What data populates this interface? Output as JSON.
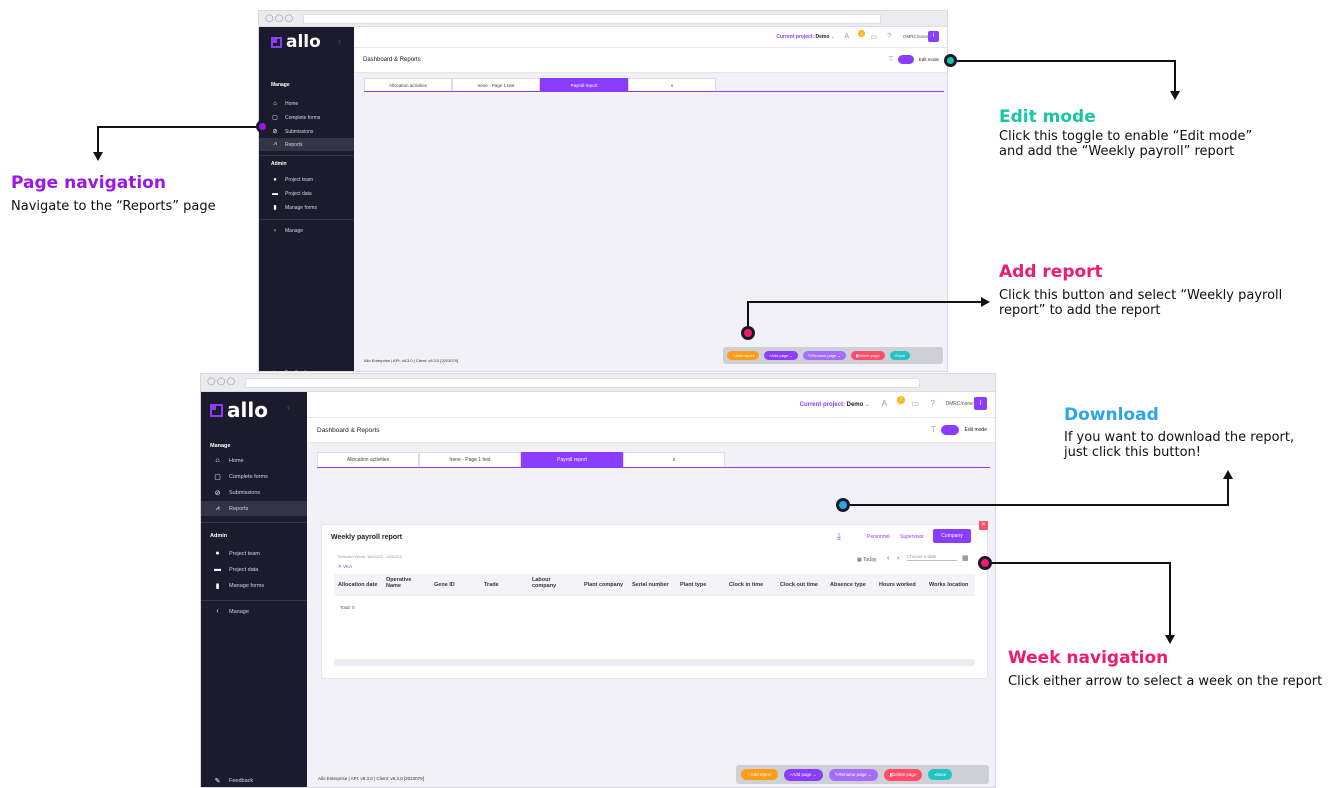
{
  "window_dots": "○○○",
  "logo_text": "allo",
  "sidebar": {
    "manage_label": "Manage",
    "items": [
      {
        "label": "Home",
        "icon": "home-icon",
        "glyph": "⌂"
      },
      {
        "label": "Complete forms",
        "icon": "form-icon",
        "glyph": "▢"
      },
      {
        "label": "Submissions",
        "icon": "submissions-icon",
        "glyph": "⊘"
      },
      {
        "label": "Reports",
        "icon": "reports-icon",
        "glyph": "⩘"
      }
    ],
    "admin_label": "Admin",
    "admin_items": [
      {
        "label": "Project team",
        "icon": "team-icon",
        "glyph": "●"
      },
      {
        "label": "Project data",
        "icon": "data-icon",
        "glyph": "▬"
      },
      {
        "label": "Manage forms",
        "icon": "forms-icon",
        "glyph": "▮"
      }
    ],
    "collapse_label": "Manage",
    "feedback_label": "Feedback"
  },
  "topbar": {
    "current_project_label": "Current project:",
    "current_project_value": "Demo",
    "user_label": "DMRC/none",
    "avatar_letter": "I",
    "notification_count": "3"
  },
  "header": {
    "title": "Dashboard & Reports",
    "edit_mode_label": "Edit mode"
  },
  "tabs": [
    "Allocation activities",
    "Irene - Page 1 test",
    "Payroll report",
    "s"
  ],
  "footer_text": "Allo Enterprise | API: v8.3.0 | Client: v8.3.0 [2023079]",
  "actions": {
    "add_report": "+ Add report",
    "add_page": "Add page ⌄",
    "rename_page": "Rename page ⌄",
    "delete_page": "Delete page",
    "save": "Save"
  },
  "report": {
    "title": "Weekly payroll report",
    "views": [
      "Personnel",
      "Supervisor",
      "Company"
    ],
    "selected_week": "Selected Week: 16/01/23 - 16/01/23",
    "filter_chip": "VKA",
    "today_label": "Today",
    "date_placeholder": "Choose a date",
    "columns": [
      "Allocation date",
      "Operative Name",
      "Gene ID",
      "Trade",
      "Labour company",
      "Plant company",
      "Serial number",
      "Plant type",
      "Clock in time",
      "Clock out time",
      "Absence type",
      "Hours worked",
      "Works location"
    ],
    "total": "Total: 0"
  },
  "annotations": {
    "page_nav": {
      "title": "Page navigation",
      "body": "Navigate to the “Reports” page",
      "color": "#9b16e8"
    },
    "edit_mode": {
      "title": "Edit mode",
      "body": "Click this toggle to enable “Edit mode” and add the “Weekly payroll” report",
      "color": "#17c6a4"
    },
    "add_report": {
      "title": "Add report",
      "body": "Click this button and select “Weekly payroll report” to add the report",
      "color": "#ee1b6e"
    },
    "download": {
      "title": "Download",
      "body": "If you want to download the report, just click this button!",
      "color": "#2aa7ec"
    },
    "week_nav": {
      "title": "Week navigation",
      "body": "Click either arrow to select a week on the report",
      "color": "#ee1b6e"
    }
  },
  "colors": {
    "accent": "#8b3dff",
    "sidebar": "#1c1b2e",
    "orange": "#ff9d17",
    "red": "#ff4d6a",
    "teal": "#23c4c4"
  }
}
